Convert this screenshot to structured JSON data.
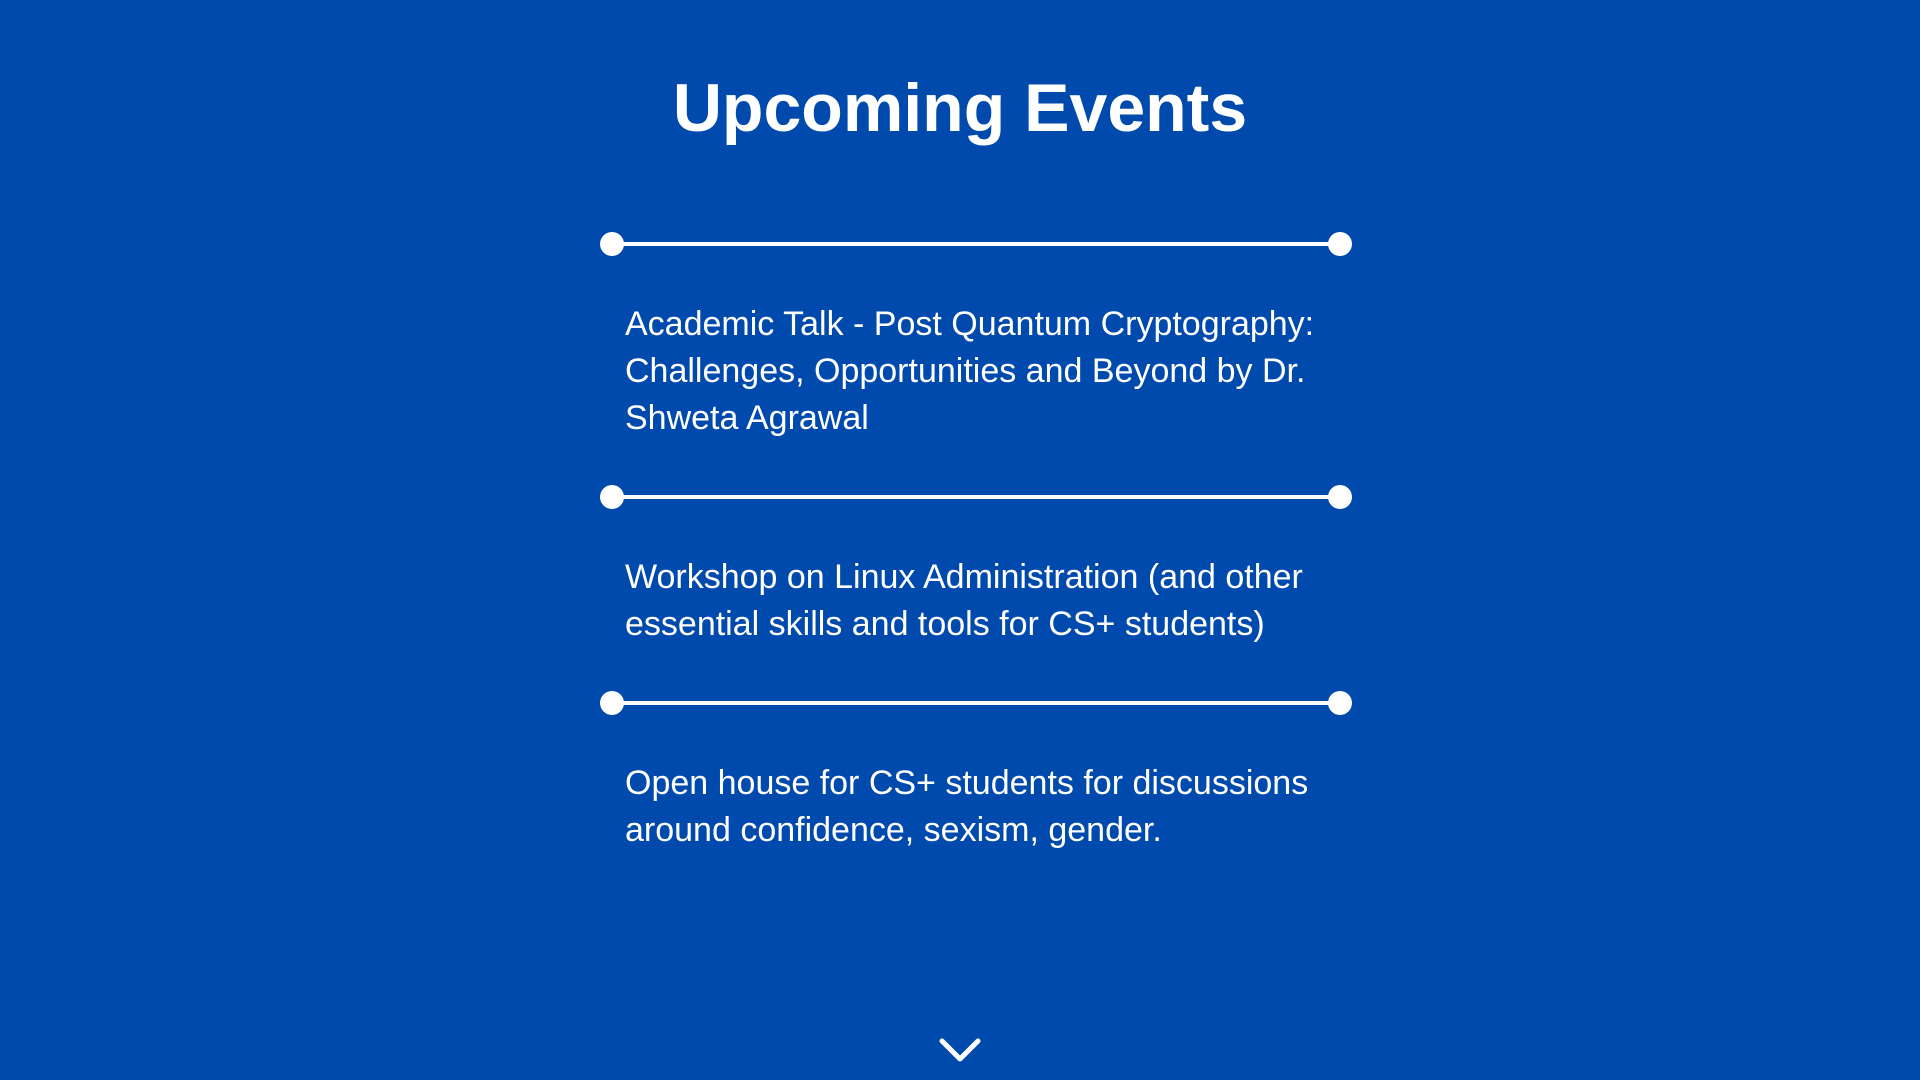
{
  "title": "Upcoming Events",
  "events": [
    {
      "text": "Academic Talk - Post Quantum Cryptography: Challenges, Opportunities and Beyond by Dr. Shweta Agrawal"
    },
    {
      "text": "Workshop on Linux Administration (and other essential skills and tools for CS+ students)"
    },
    {
      "text": "Open house for CS+ students for discussions around confidence, sexism, gender."
    }
  ],
  "colors": {
    "background": "#004aad",
    "foreground": "#ffffff"
  },
  "icons": {
    "scroll": "chevron-down-icon"
  }
}
